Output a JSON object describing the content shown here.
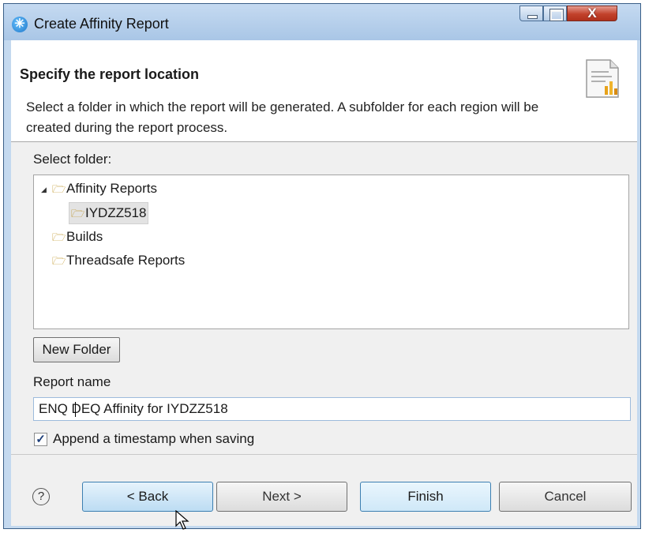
{
  "window": {
    "title": "Create Affinity Report",
    "icon": "asterisk-app-icon",
    "controls": {
      "minimize": "minimize-icon",
      "maximize": "maximize-icon",
      "close": "X"
    }
  },
  "banner": {
    "title": "Specify the report location",
    "description": "Select a folder in which the report will be generated. A subfolder for each region will be created during the report process."
  },
  "folder_section": {
    "label": "Select folder:",
    "tree": [
      {
        "label": "Affinity Reports",
        "expanded": true,
        "level": 0
      },
      {
        "label": "IYDZZ518",
        "selected": true,
        "level": 1
      },
      {
        "label": "Builds",
        "level": 0
      },
      {
        "label": "Threadsafe Reports",
        "level": 0
      }
    ]
  },
  "new_folder_label": "New Folder",
  "report_name": {
    "label": "Report name",
    "value": "ENQ DEQ Affinity for IYDZZ518"
  },
  "timestamp_checkbox": {
    "label": "Append a timestamp when saving",
    "checked": true
  },
  "footer": {
    "help": "?",
    "back": "< Back",
    "next": "Next >",
    "finish": "Finish",
    "cancel": "Cancel"
  },
  "colors": {
    "accent": "#3c7fb1",
    "title_bar": "#a9c6e6",
    "close_button": "#c2412b",
    "folder": "#b88a12"
  }
}
